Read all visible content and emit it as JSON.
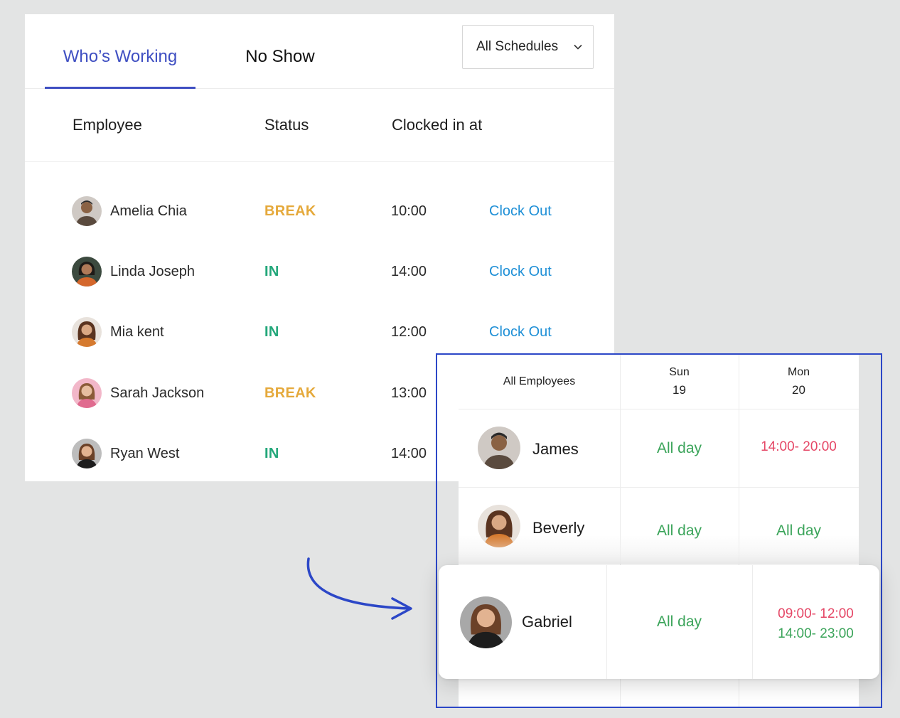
{
  "tabs": [
    {
      "label": "Who’s Working",
      "active": true
    },
    {
      "label": "No Show",
      "active": false
    }
  ],
  "schedule_filter": {
    "selected": "All Schedules"
  },
  "table": {
    "columns": [
      "Employee",
      "Status",
      "Clocked in at"
    ],
    "rows": [
      {
        "name": "Amelia Chia",
        "status": "BREAK",
        "status_color": "#e5a93b",
        "clocked_in": "10:00",
        "action": "Clock Out"
      },
      {
        "name": "Linda Joseph",
        "status": "IN",
        "status_color": "#23a77a",
        "clocked_in": "14:00",
        "action": "Clock Out"
      },
      {
        "name": "Mia kent",
        "status": "IN",
        "status_color": "#23a77a",
        "clocked_in": "12:00",
        "action": "Clock Out"
      },
      {
        "name": "Sarah Jackson",
        "status": "BREAK",
        "status_color": "#e5a93b",
        "clocked_in": "13:00",
        "action": ""
      },
      {
        "name": "Ryan West",
        "status": "IN",
        "status_color": "#23a77a",
        "clocked_in": "14:00",
        "action": ""
      }
    ]
  },
  "schedule": {
    "header": {
      "employees_label": "All Employees"
    },
    "days": [
      {
        "day": "Sun",
        "date": "19"
      },
      {
        "day": "Mon",
        "date": "20"
      }
    ],
    "rows": [
      {
        "name": "James",
        "sun": "All day",
        "mon": "14:00- 20:00"
      },
      {
        "name": "Beverly",
        "sun": "All day",
        "mon": "All day"
      },
      {
        "name": "Gabriel",
        "sun": "All day",
        "mon_shift_1": "09:00- 12:00",
        "mon_shift_2": "14:00- 23:00"
      }
    ]
  },
  "colors": {
    "accent": "#3f4fc2",
    "link": "#1e8fd6",
    "break": "#e5a93b",
    "in": "#23a77a",
    "all_day": "#3ba45a",
    "shift_red": "#e54766",
    "frame_border": "#2c47c7"
  }
}
